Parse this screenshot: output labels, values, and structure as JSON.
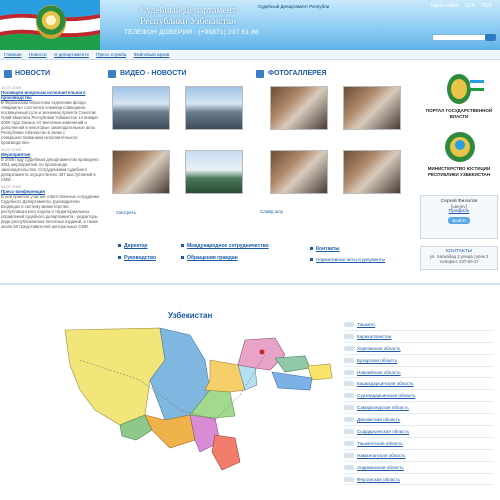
{
  "header": {
    "title_line1": "Судебный Департамент",
    "title_line2": "Республики Узбекистан",
    "hotline": "ТЕЛЕФОН ДОВЕРИЯ : (+99871) 237 61 86",
    "top_small": "Судебный Департамент Республи",
    "top_links": [
      "Карта сайта",
      "UZB",
      "RUS"
    ]
  },
  "nav": [
    "Главная",
    "Новости",
    "О департаменте",
    "Пресс-служба",
    "Файловый архив"
  ],
  "news": {
    "title": "НОВОСТИ",
    "items": [
      {
        "date": "10.07.2009",
        "title": "Посвящен вопросам исполнительного производства",
        "body": "В Ферганском областном отделении фонда «Мараиль» состоялся семинар-совещание, посвященный сути и значению проекта Сенатом Олий Мажлиса Республики Узбекистан 14 января 2009 года Закона «О внесении изменений и дополнений в некоторые законодательные акты Республики Узбекистан в связи с совершенствованием исполнительного производства»"
      },
      {
        "date": "03.07.2009",
        "title": "Мероприятия",
        "body": "В 2008 году Судебным департаментом проведено 2911 мероприятий, по пропаганде законодательства. Сотрудниками судебного департамента осуществлено 487 выступлений в СМИ."
      },
      {
        "date": "03.07.2009",
        "title": "Пресс-конференция",
        "body": "В ней приняли участие ответственные сотрудники Судебного Департамента, руководители входящих в систему министерства республиканского отдела и территориальных управлений судебного департамента - редакторы ряда республиканских печатных изданий, а также около 50 представителей центральных СМИ."
      }
    ]
  },
  "video": {
    "title": "ВИДЕО - НОВОСТИ",
    "watch_label": "Смотреть"
  },
  "gallery": {
    "title": "ФОТОГАЛЛЕРЕЯ",
    "slideshow_label": "Слайд шоу"
  },
  "links": {
    "col1": [
      "Директор",
      "Руководство"
    ],
    "col2": [
      "Международное сотрудничество",
      "Обращения граждан"
    ],
    "col3": [
      "Контакты",
      "Нормативные акты и документы"
    ]
  },
  "right": {
    "portal_label": "ПОРТАЛ ГОСУДАРСТВЕННОЙ ВЛАСТИ",
    "ministry_label": "МИНИСТЕРСТВО ЮСТИЦИИ РЕСПУБЛИКИ УЗБЕКИСТАН",
    "user_name": "Сергей Филатов",
    "user_login": "[ьвеjev]",
    "profile_label": "Профиль",
    "logout_label": "Выйти",
    "contacts_title": "КОНТАКТЫ",
    "contacts_address": "ул. Халкабад 3 улица тупик 2",
    "contacts_phone": "телефон: 237-60-17"
  },
  "map": {
    "title": "Узбекистан",
    "regions": [
      "Ташкент",
      "Каракалпакстан",
      "Хорезмская область",
      "Бухарская область",
      "Навоийская область",
      "Кашкадарьинская область",
      "Сурхандарьинская область",
      "Самаркандская область",
      "Джизакская область",
      "Сырдарьинская область",
      "Ташкентская область",
      "Наманганская область",
      "Андижанская область",
      "Ферганская область"
    ]
  },
  "colors": {
    "accent": "#1a5aa6",
    "header_top": "#c8e9fb",
    "header_bottom": "#5fb2e8"
  }
}
